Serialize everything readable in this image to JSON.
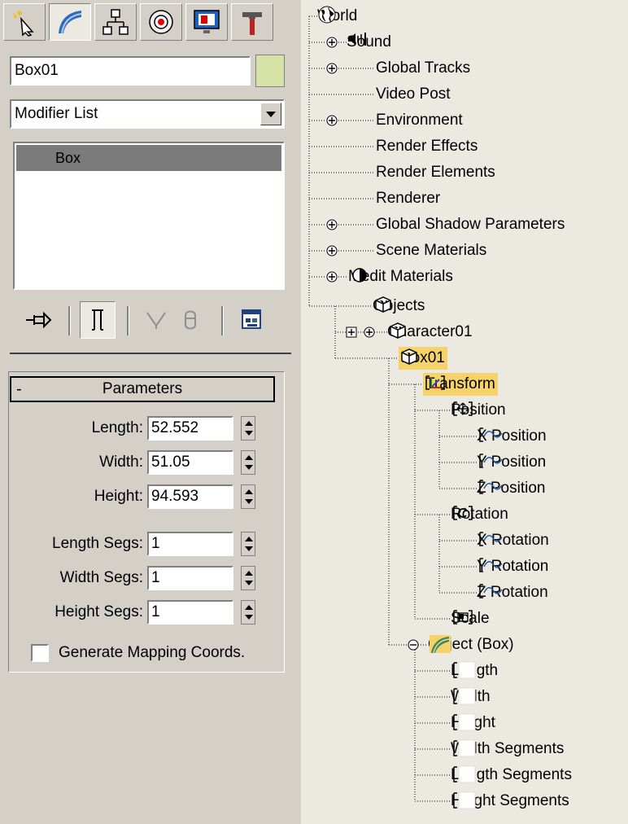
{
  "command_panel": {
    "tabs": [
      "create-icon",
      "modify-icon",
      "hierarchy-icon",
      "motion-icon",
      "display-icon",
      "utilities-icon"
    ],
    "object_name": "Box01",
    "object_color": "#d6e2a6",
    "modifier_list": "Modifier List",
    "stack_items": [
      "Box"
    ],
    "stack_toolbar": [
      "pin-stack-icon",
      "show-end-result-icon",
      "make-unique-icon",
      "remove-modifier-icon",
      "configure-modifier-sets-icon"
    ]
  },
  "parameters": {
    "header": "Parameters",
    "collapse": "-",
    "fields": [
      {
        "label": "Length:",
        "value": "52.552"
      },
      {
        "label": "Width:",
        "value": "51.05"
      },
      {
        "label": "Height:",
        "value": "94.593"
      },
      {
        "label": "Length Segs:",
        "value": "1"
      },
      {
        "label": "Width Segs:",
        "value": "1"
      },
      {
        "label": "Height Segs:",
        "value": "1"
      }
    ],
    "mapping_label": "Generate Mapping Coords."
  },
  "tree": {
    "nodes": [
      {
        "label": "World"
      },
      {
        "label": "Sound"
      },
      {
        "label": "Global Tracks"
      },
      {
        "label": "Video Post"
      },
      {
        "label": "Environment"
      },
      {
        "label": "Render Effects"
      },
      {
        "label": "Render Elements"
      },
      {
        "label": "Renderer"
      },
      {
        "label": "Global Shadow Parameters"
      },
      {
        "label": "Scene Materials"
      },
      {
        "label": "Medit Materials"
      },
      {
        "label": "Objects"
      },
      {
        "label": "Character01"
      },
      {
        "label": "Box01"
      },
      {
        "label": "Transform"
      },
      {
        "label": "Position"
      },
      {
        "label": "X Position"
      },
      {
        "label": "Y Position"
      },
      {
        "label": "Z Position"
      },
      {
        "label": "Rotation"
      },
      {
        "label": "X Rotation"
      },
      {
        "label": "Y Rotation"
      },
      {
        "label": "Z Rotation"
      },
      {
        "label": "Scale"
      },
      {
        "label": "Object (Box)"
      },
      {
        "label": "Length"
      },
      {
        "label": "Width"
      },
      {
        "label": "Height"
      },
      {
        "label": "Width Segments"
      },
      {
        "label": "Length Segments"
      },
      {
        "label": "Height Segments"
      }
    ],
    "highlight_color": "#f6d36a"
  }
}
